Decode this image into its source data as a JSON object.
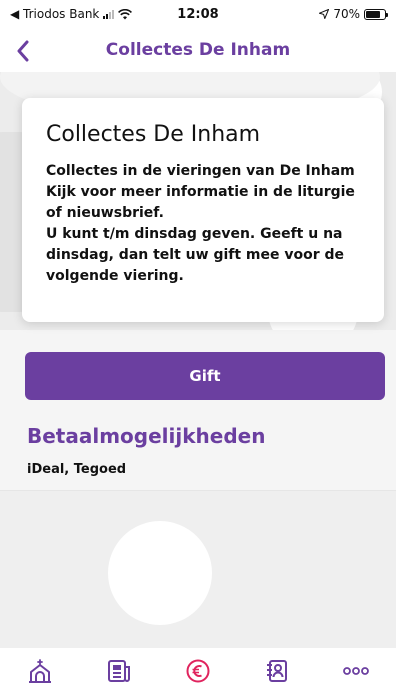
{
  "status_bar": {
    "carrier": "◀ Triodos Bank",
    "time": "12:08",
    "battery": "70%"
  },
  "nav": {
    "title": "Collectes De Inham",
    "back_icon": "chevron-left-icon"
  },
  "card": {
    "title": "Collectes De Inham",
    "lines": [
      "Collectes in de vieringen van De Inham",
      "Kijk voor meer informatie in de liturgie of nieuwsbrief.",
      "U kunt t/m dinsdag geven. Geeft u na dinsdag, dan telt uw gift mee voor de volgende viering."
    ]
  },
  "gift_button": {
    "label": "Gift"
  },
  "payment": {
    "heading": "Betaalmogelijkheden",
    "methods": "iDeal, Tegoed"
  },
  "tabbar": {
    "items": [
      {
        "icon": "church-icon"
      },
      {
        "icon": "newspaper-icon"
      },
      {
        "icon": "euro-icon"
      },
      {
        "icon": "contacts-icon"
      },
      {
        "icon": "more-icon"
      }
    ]
  },
  "colors": {
    "accent": "#6b3fa0",
    "background": "#f5f5f5",
    "card": "#ffffff"
  }
}
